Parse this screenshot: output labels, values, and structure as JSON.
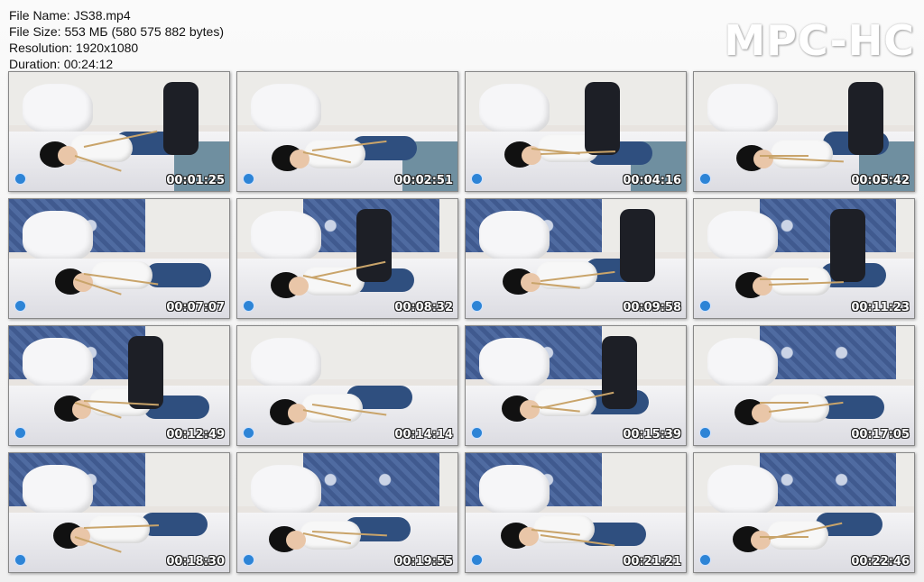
{
  "file_info": {
    "name_line": "File Name: JS38.mp4",
    "size_line": "File Size: 553 МБ (580 575 882 bytes)",
    "resolution_line": "Resolution: 1920x1080",
    "duration_line": "Duration: 00:24:12"
  },
  "brand": "MPC-HC",
  "thumbnails": [
    {
      "time": "00:01:25"
    },
    {
      "time": "00:02:51"
    },
    {
      "time": "00:04:16"
    },
    {
      "time": "00:05:42"
    },
    {
      "time": "00:07:07"
    },
    {
      "time": "00:08:32"
    },
    {
      "time": "00:09:58"
    },
    {
      "time": "00:11:23"
    },
    {
      "time": "00:12:49"
    },
    {
      "time": "00:14:14"
    },
    {
      "time": "00:15:39"
    },
    {
      "time": "00:17:05"
    },
    {
      "time": "00:18:30"
    },
    {
      "time": "00:19:55"
    },
    {
      "time": "00:21:21"
    },
    {
      "time": "00:22:46"
    }
  ],
  "colors": {
    "timestamp": "#ffffff",
    "wall_pattern": "#2e4b86",
    "jeans": "#2f4f7f",
    "rope": "#c9a46a"
  }
}
